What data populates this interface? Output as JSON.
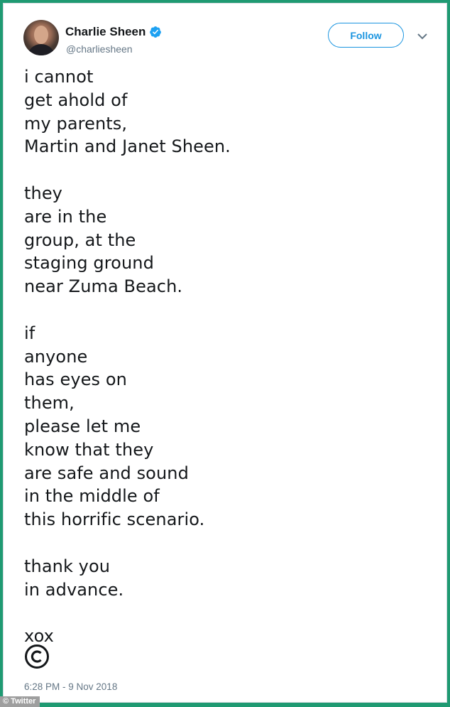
{
  "profile": {
    "display_name": "Charlie Sheen",
    "handle": "@charliesheen",
    "verified_icon": "verified-badge-icon",
    "avatar_icon": "profile-avatar"
  },
  "actions": {
    "follow_label": "Follow",
    "menu_icon": "chevron-down-icon"
  },
  "tweet": {
    "text": "i cannot\nget ahold of\nmy parents,\nMartin and Janet Sheen.\n\nthey\nare in the\ngroup, at the\nstaging ground\nnear Zuma Beach.\n\nif\nanyone\nhas eyes on\nthem,\nplease let me\nknow that they\nare safe and sound\nin the middle of\nthis horrific scenario.\n\nthank you\nin advance.\n\nxox",
    "emoji_icon": "copyright-icon",
    "timestamp": "6:28 PM - 9 Nov 2018"
  },
  "watermark": "© Twitter",
  "colors": {
    "frame": "#1f9a72",
    "accent": "#1b95e0",
    "text": "#14171a",
    "muted": "#657786"
  }
}
